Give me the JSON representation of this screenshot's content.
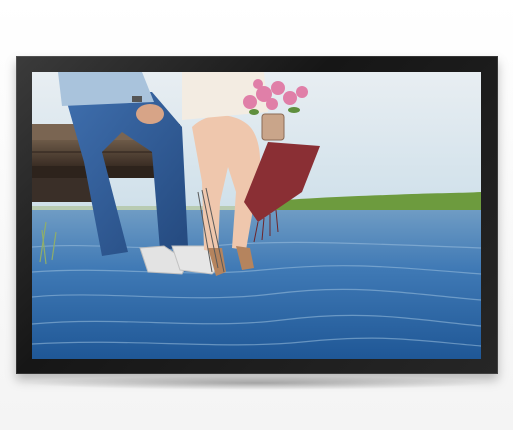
{
  "scene": {
    "subject": "couple-sitting-on-dock-over-lake",
    "frame_color": "#1e1e1e",
    "wall_color": "#ffffff",
    "sky_color": "#dfe9ef",
    "water_color": "#2f6aa8",
    "far_shore_color": "#6d9b3e",
    "flower_color": "#e07fa8",
    "blanket_color": "#8a2f34"
  }
}
